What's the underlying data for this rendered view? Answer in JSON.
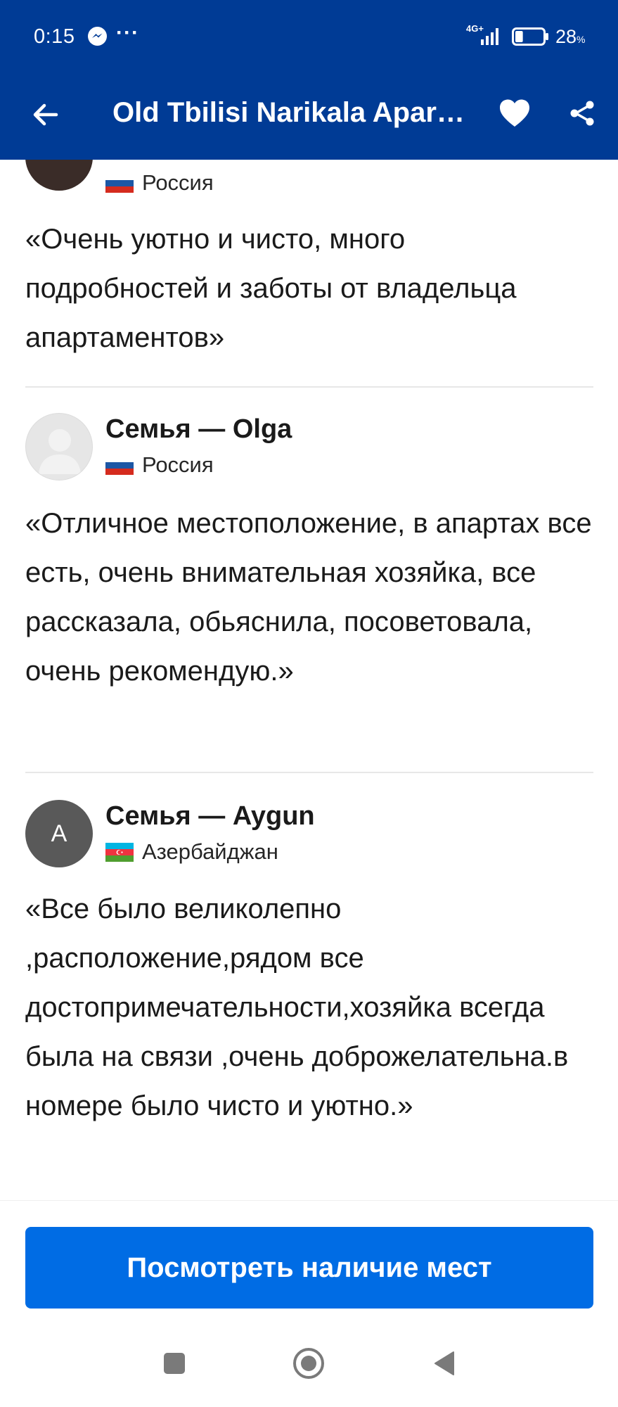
{
  "status_bar": {
    "time": "0:15",
    "overflow_dots": "···",
    "network": "4G+",
    "battery_percent": "28",
    "battery_unit": "%",
    "battery_level": 0.28
  },
  "app_bar": {
    "title": "Old Tbilisi Narikala Apartments"
  },
  "reviews": [
    {
      "country": "Россия",
      "flag": "russia",
      "text": "«Очень уютно и чисто, много подробностей и заботы от владельца апартаментов»"
    },
    {
      "name": "Семья — Olga",
      "country": "Россия",
      "flag": "russia",
      "text": "«Отличное местоположение, в апартах все есть, очень внимательная хозяйка, все рассказала, обьяснила, посоветовала, очень рекомендую.»"
    },
    {
      "name": "Семья — Aygun",
      "avatar_initial": "A",
      "country": "Азербайджан",
      "flag": "azerbaijan",
      "text": "«Все было великолепно ,расположение,рядом все достопримечательности,хозяйка всегда была на связи ,очень доброжелательна.в номере было чисто и уютно.»"
    }
  ],
  "cta": {
    "label": "Посмотреть наличие мест"
  },
  "colors": {
    "header": "#003b95",
    "cta": "#006ce4"
  },
  "icons": {
    "back": "arrow-left-icon",
    "favorite": "heart-icon",
    "share": "share-icon"
  }
}
